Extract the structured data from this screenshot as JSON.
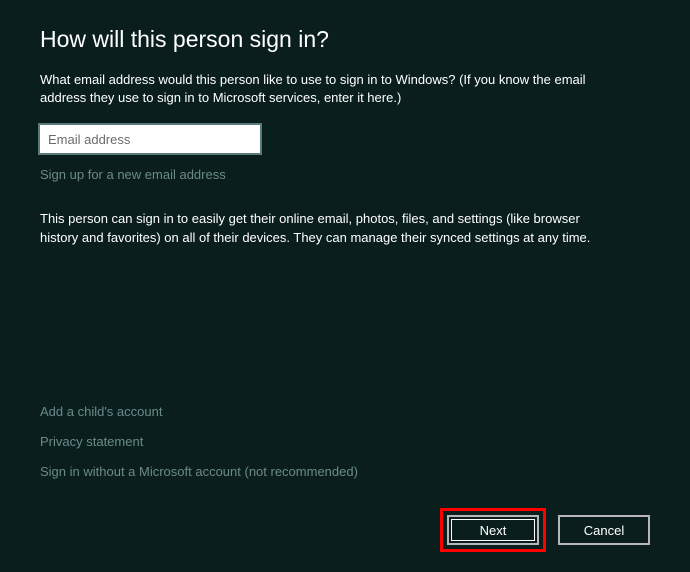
{
  "heading": "How will this person sign in?",
  "description": "What email address would this person like to use to sign in to Windows? (If you know the email address they use to sign in to Microsoft services, enter it here.)",
  "email": {
    "value": "",
    "placeholder": "Email address"
  },
  "signup_link": "Sign up for a new email address",
  "info_text": "This person can sign in to easily get their online email, photos, files, and settings (like browser history and favorites) on all of their devices. They can manage their synced settings at any time.",
  "bottom_links": {
    "add_child": "Add a child's account",
    "privacy": "Privacy statement",
    "no_ms_account": "Sign in without a Microsoft account (not recommended)"
  },
  "buttons": {
    "next": "Next",
    "cancel": "Cancel"
  }
}
